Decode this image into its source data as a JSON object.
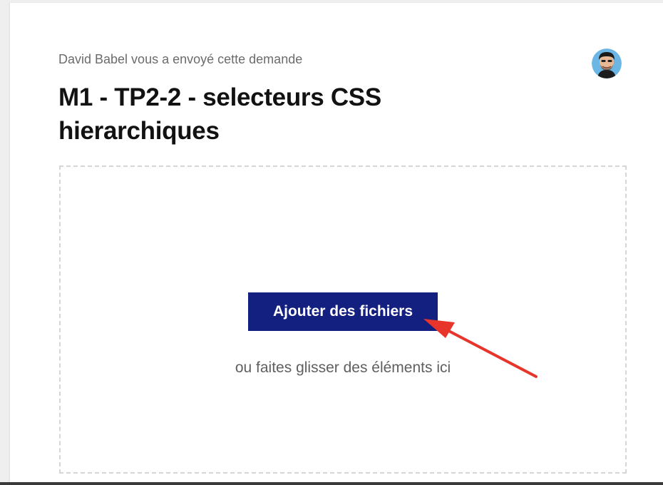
{
  "request": {
    "sender_text": "David Babel vous a envoyé cette demande",
    "title": "M1 - TP2-2 - selecteurs CSS hierarchiques"
  },
  "upload": {
    "button_label": "Ajouter des fichiers",
    "drag_hint": "ou faites glisser des éléments ici"
  },
  "colors": {
    "button_bg": "#142080",
    "annotation_arrow": "#e8352c",
    "dropzone_border": "#d6d6d6"
  },
  "icons": {
    "avatar": "avatar-cartoon-icon",
    "annotation": "red-arrow-annotation"
  }
}
